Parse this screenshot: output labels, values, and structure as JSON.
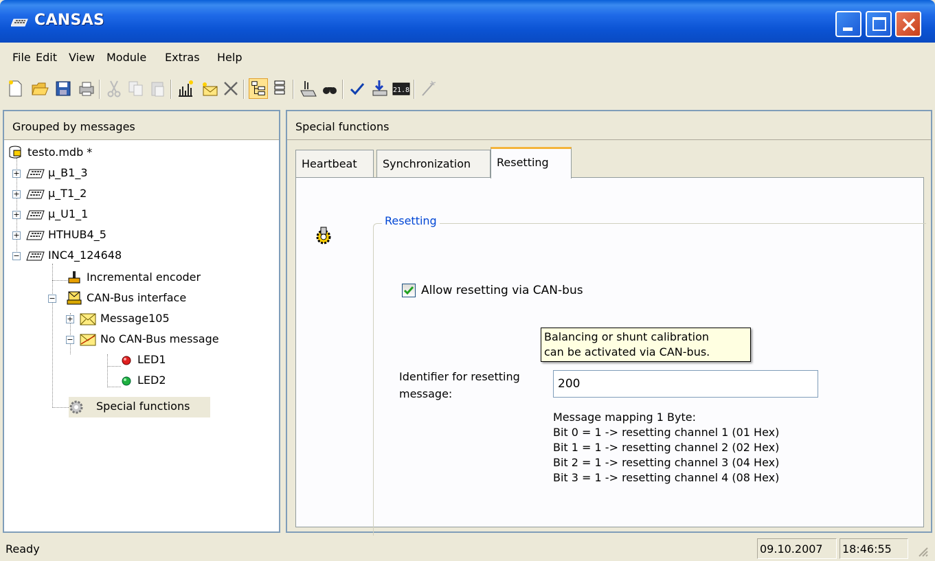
{
  "window": {
    "title": "CANSAS"
  },
  "menu": [
    "File",
    "Edit",
    "View",
    "Module",
    "Extras",
    "Help"
  ],
  "left": {
    "header": "Grouped by messages",
    "tree": [
      "testo.mdb *",
      "µ_B1_3",
      "µ_T1_2",
      "µ_U1_1",
      "HTHUB4_5",
      "INC4_124648",
      "Incremental encoder",
      "CAN-Bus interface",
      "Message105",
      "No CAN-Bus message",
      "LED1",
      "LED2",
      "Special functions"
    ]
  },
  "right": {
    "header": "Special functions",
    "tabs": [
      "Heartbeat",
      "Synchronization",
      "Resetting"
    ],
    "active_tab": "Resetting",
    "group_title": "Resetting",
    "checkbox_label": "Allow resetting via CAN-bus",
    "checkbox_checked": true,
    "identifier_label_1": "Identifier for resetting",
    "identifier_label_2": "message:",
    "identifier_value": "200",
    "tooltip_1": "Balancing or shunt calibration",
    "tooltip_2": "can be activated via CAN-bus.",
    "mapping": [
      "Message mapping 1 Byte:",
      "Bit 0 = 1 -> resetting channel 1 (01 Hex)",
      "Bit 1 = 1 -> resetting channel 2 (02 Hex)",
      "Bit 2 = 1 -> resetting channel 3 (04 Hex)",
      "Bit 3 = 1 -> resetting channel 4 (08 Hex)"
    ]
  },
  "status": {
    "text": "Ready",
    "date": "09.10.2007",
    "time": "18:46:55"
  },
  "toolbar_icons": [
    "new-icon",
    "open-icon",
    "save-icon",
    "print-icon",
    "cut-icon",
    "copy-icon",
    "paste-icon",
    "measure-icon",
    "envelope-icon",
    "delete-icon",
    "tree-view-icon",
    "list-view-icon",
    "module-icon",
    "find-icon",
    "check-icon",
    "download-icon",
    "display-icon",
    "wand-icon"
  ]
}
